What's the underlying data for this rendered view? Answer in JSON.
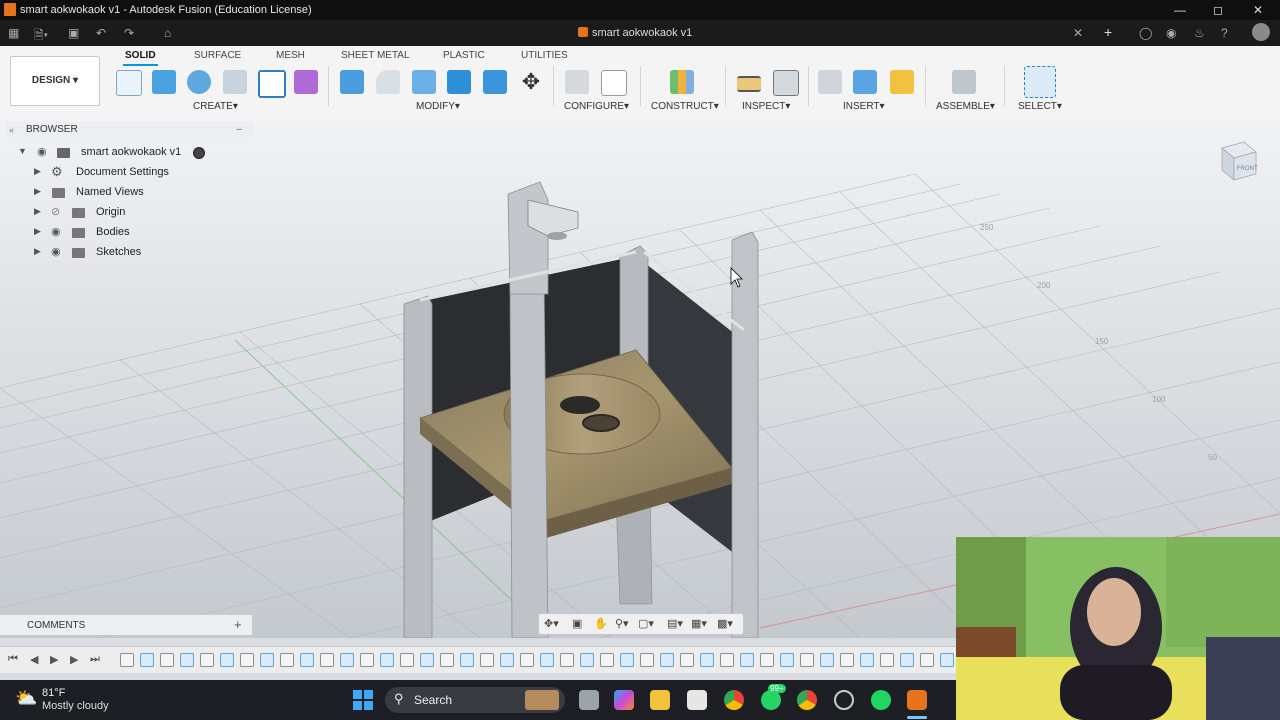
{
  "window": {
    "title": "smart aokwokaok v1 - Autodesk Fusion (Education License)"
  },
  "document_tab": {
    "name": "smart aokwokaok v1"
  },
  "ribbon": {
    "tabs": [
      "SOLID",
      "SURFACE",
      "MESH",
      "SHEET METAL",
      "PLASTIC",
      "UTILITIES"
    ],
    "active_tab": "SOLID",
    "workspace": "DESIGN",
    "groups": [
      "CREATE",
      "MODIFY",
      "CONFIGURE",
      "CONSTRUCT",
      "INSPECT",
      "INSERT",
      "ASSEMBLE",
      "SELECT"
    ]
  },
  "browser": {
    "title": "BROWSER",
    "root": "smart aokwokaok v1",
    "items": [
      {
        "label": "Document Settings",
        "icon": "gear-icon"
      },
      {
        "label": "Named Views",
        "icon": "folder-icon"
      },
      {
        "label": "Origin",
        "icon": "folder-icon"
      },
      {
        "label": "Bodies",
        "icon": "folder-icon"
      },
      {
        "label": "Sketches",
        "icon": "folder-icon"
      }
    ]
  },
  "viewcube": {
    "face": "FRONT"
  },
  "grid_labels": [
    "250",
    "200",
    "150",
    "100",
    "50"
  ],
  "comments": {
    "label": "COMMENTS"
  },
  "taskbar": {
    "weather_temp": "81°F",
    "weather_desc": "Mostly cloudy",
    "search_label": "Search",
    "chat_badge": "99+"
  },
  "colors": {
    "accent": "#0696d7",
    "fusion_orange": "#e8731d",
    "taskbar": "#1e1f25"
  }
}
